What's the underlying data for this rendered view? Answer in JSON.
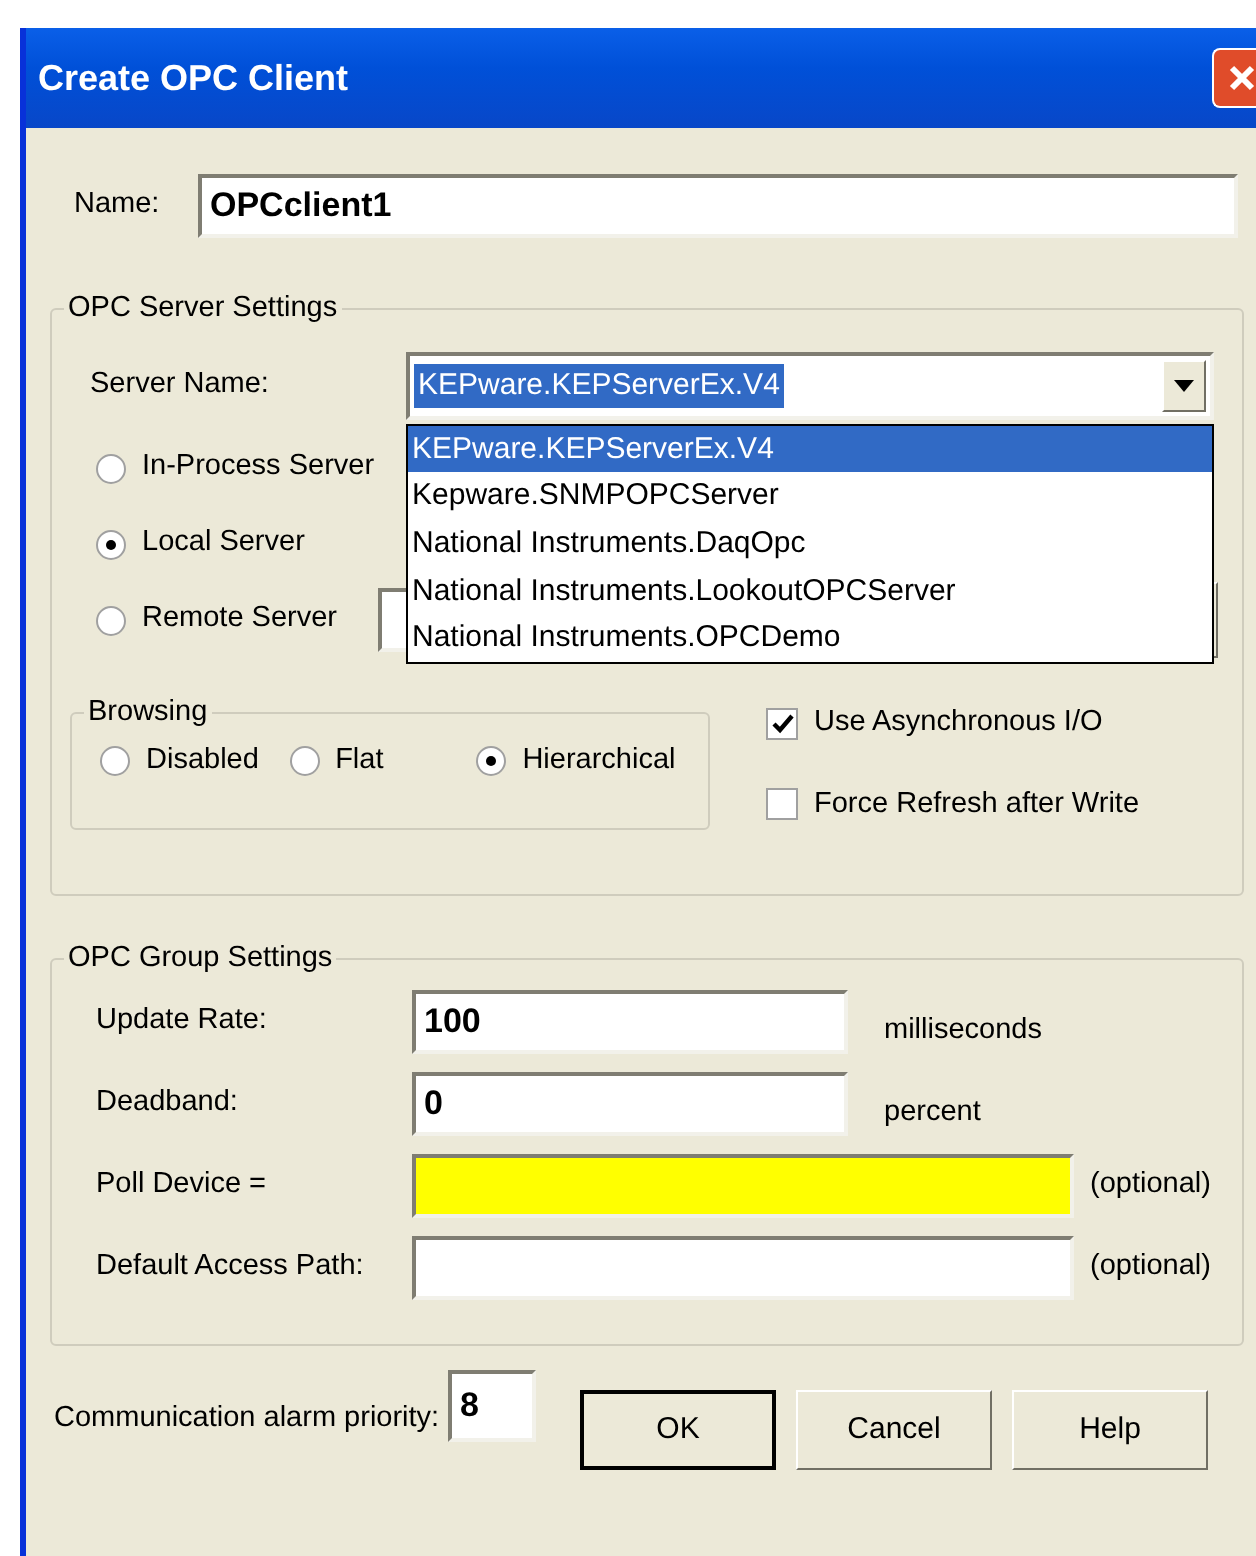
{
  "window": {
    "title": "Create OPC Client"
  },
  "name": {
    "label": "Name:",
    "value": "OPCclient1"
  },
  "server_settings": {
    "title": "OPC Server Settings",
    "server_name": {
      "label": "Server Name:",
      "value": "KEPware.KEPServerEx.V4",
      "expanded": true,
      "options": [
        {
          "label": "KEPware.KEPServerEx.V4",
          "selected": true
        },
        {
          "label": "Kepware.SNMPOPCServer",
          "selected": false
        },
        {
          "label": "National Instruments.DaqOpc",
          "selected": false
        },
        {
          "label": "National Instruments.LookoutOPCServer",
          "selected": false
        },
        {
          "label": "National Instruments.OPCDemo",
          "selected": false
        }
      ]
    },
    "server_types": [
      {
        "label": "In-Process Server",
        "selected": false
      },
      {
        "label": "Local Server",
        "selected": true
      },
      {
        "label": "Remote Server",
        "selected": false
      }
    ],
    "browsing": {
      "title": "Browsing",
      "options": [
        {
          "label": "Disabled",
          "selected": false
        },
        {
          "label": "Flat",
          "selected": false
        },
        {
          "label": "Hierarchical",
          "selected": true
        }
      ]
    },
    "checkboxes": [
      {
        "label": "Use Asynchronous I/O",
        "checked": true
      },
      {
        "label": "Force Refresh after Write",
        "checked": false
      }
    ]
  },
  "group_settings": {
    "title": "OPC Group Settings",
    "fields": [
      {
        "label": "Update Rate:",
        "value": "100",
        "unit": "milliseconds",
        "highlighted": false
      },
      {
        "label": "Deadband:",
        "value": "0",
        "unit": "percent",
        "highlighted": false
      },
      {
        "label": "Poll Device =",
        "unit": "(optional)",
        "highlighted": true
      },
      {
        "label": "Default Access Path:",
        "unit": "(optional)",
        "highlighted": false
      }
    ]
  },
  "alarm_priority": {
    "label": "Communication alarm priority:",
    "value": "8"
  },
  "buttons": [
    {
      "label": "OK",
      "default": true
    },
    {
      "label": "Cancel",
      "default": false
    },
    {
      "label": "Help",
      "default": false
    }
  ]
}
